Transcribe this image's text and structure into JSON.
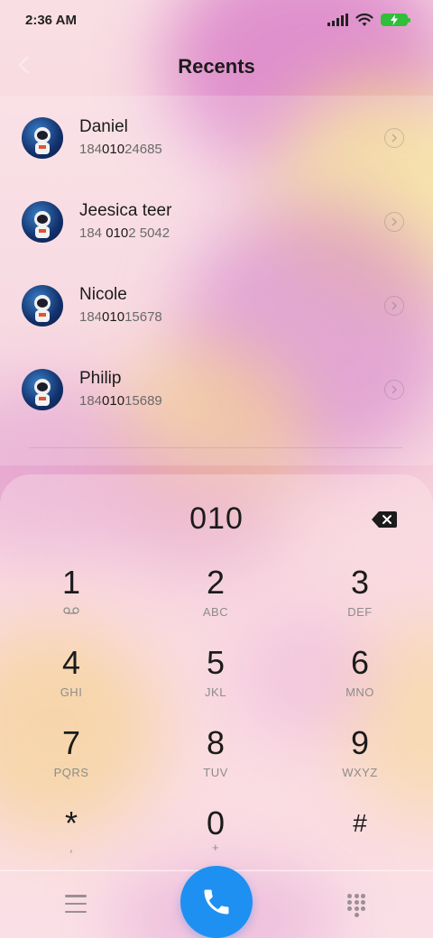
{
  "status_bar": {
    "time": "2:36 AM"
  },
  "header": {
    "title": "Recents"
  },
  "contacts": [
    {
      "name": "Daniel",
      "number_prefix": "184",
      "number_match": "010",
      "number_suffix": "24685"
    },
    {
      "name": "Jeesica teer",
      "number_prefix": "184 ",
      "number_match": "010",
      "number_suffix": "2 5042"
    },
    {
      "name": "Nicole",
      "number_prefix": "184",
      "number_match": "010",
      "number_suffix": "15678"
    },
    {
      "name": "Philip",
      "number_prefix": "184",
      "number_match": "010",
      "number_suffix": "15689"
    }
  ],
  "dialer": {
    "entry": "010",
    "keys": [
      {
        "digit": "1",
        "letters": ""
      },
      {
        "digit": "2",
        "letters": "ABC"
      },
      {
        "digit": "3",
        "letters": "DEF"
      },
      {
        "digit": "4",
        "letters": "GHI"
      },
      {
        "digit": "5",
        "letters": "JKL"
      },
      {
        "digit": "6",
        "letters": "MNO"
      },
      {
        "digit": "7",
        "letters": "PQRS"
      },
      {
        "digit": "8",
        "letters": "TUV"
      },
      {
        "digit": "9",
        "letters": "WXYZ"
      },
      {
        "digit": "*",
        "letters": ","
      },
      {
        "digit": "0",
        "letters": "+"
      },
      {
        "digit": "#",
        "letters": ""
      }
    ]
  },
  "colors": {
    "call_button": "#1e90f2",
    "battery": "#2fbf3a"
  }
}
